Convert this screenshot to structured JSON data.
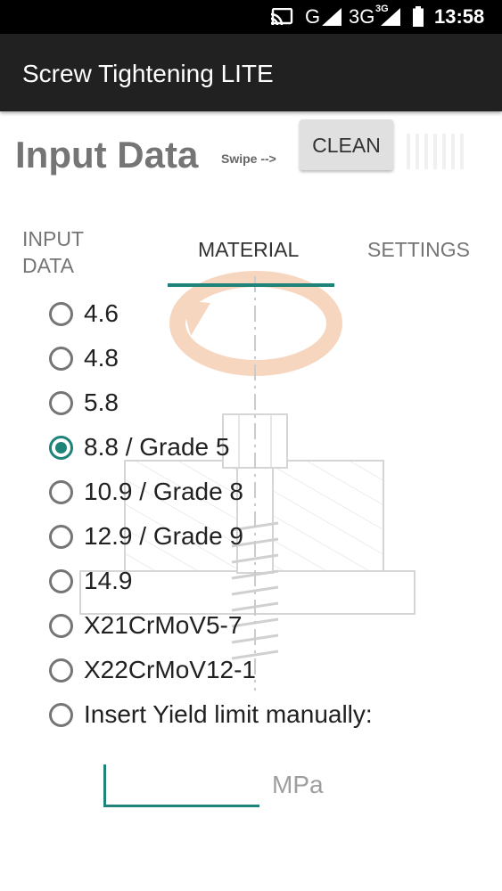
{
  "status_bar": {
    "network": "G",
    "network_3g": "3G",
    "network_3g_sup": "3G",
    "time": "13:58"
  },
  "app_bar": {
    "title": "Screw Tightening LITE"
  },
  "header": {
    "title": "Input Data",
    "swipe_hint": "Swipe -->",
    "clean_button": "CLEAN"
  },
  "tabs": [
    {
      "label_line1": "INPUT",
      "label_line2": "DATA",
      "active": false
    },
    {
      "label": "MATERIAL",
      "active": true
    },
    {
      "label": "SETTINGS",
      "active": false
    }
  ],
  "materials": {
    "options": [
      {
        "label": "4.6",
        "checked": false
      },
      {
        "label": "4.8",
        "checked": false
      },
      {
        "label": "5.8",
        "checked": false
      },
      {
        "label": "8.8 / Grade 5",
        "checked": true
      },
      {
        "label": "10.9 / Grade 8",
        "checked": false
      },
      {
        "label": "12.9 / Grade 9",
        "checked": false
      },
      {
        "label": "14.9",
        "checked": false
      },
      {
        "label": "X21CrMoV5-7",
        "checked": false
      },
      {
        "label": "X22CrMoV12-1",
        "checked": false
      },
      {
        "label": "Insert Yield limit manually:",
        "checked": false
      }
    ]
  },
  "manual_input": {
    "value": "",
    "unit": "MPa"
  },
  "colors": {
    "accent": "#1e8378",
    "app_bar": "#212121",
    "status_bar": "#000000",
    "illustration_arrow": "#f0a070"
  }
}
